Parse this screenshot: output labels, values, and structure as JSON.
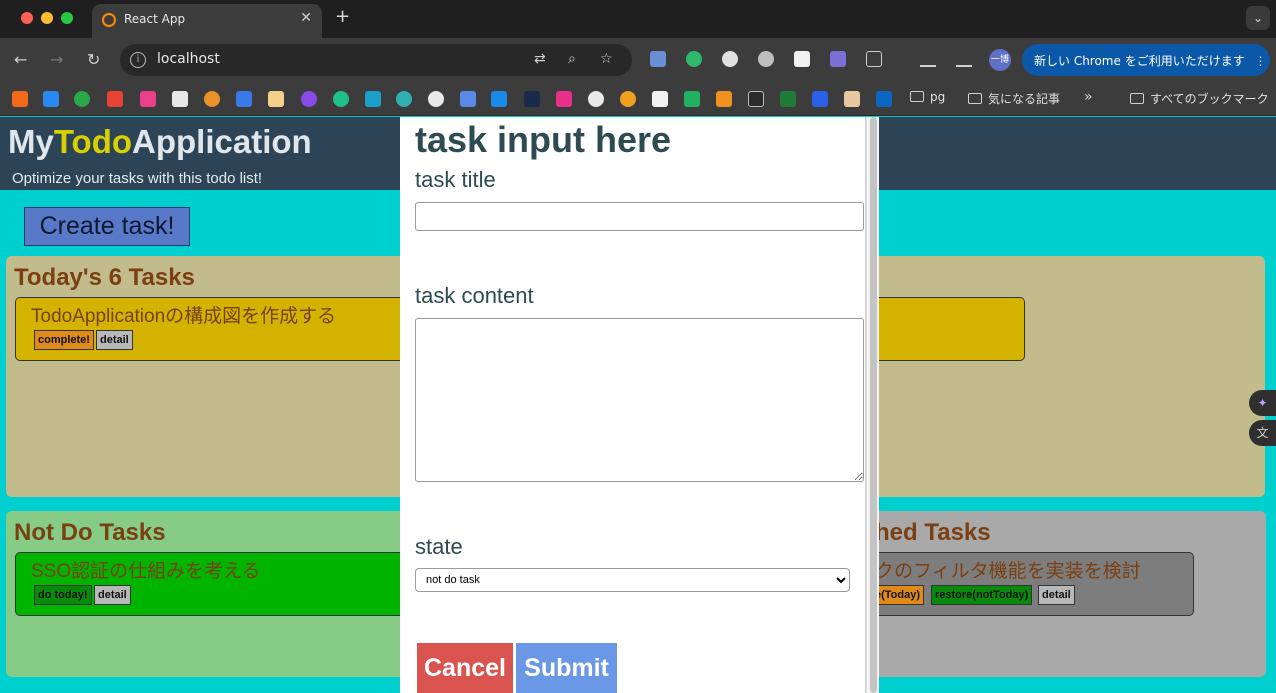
{
  "browser": {
    "tab_title": "React App",
    "new_tab": "+",
    "url": "localhost",
    "update_chip": "新しい Chrome をご利用いただけます",
    "more_glyph": "⋮",
    "bookmark_folders": [
      "pg",
      "気になる記事",
      "すべてのブックマーク"
    ]
  },
  "app": {
    "title_part1": "My",
    "title_part2": "Todo",
    "title_part3": "Application",
    "subtitle": "Optimize your tasks with this todo list!",
    "create_button": "Create task!"
  },
  "panels": {
    "today": {
      "title": "Today's 6 Tasks",
      "task_title": "TodoApplicationの構成図を作成する",
      "btn_complete": "complete!",
      "btn_detail": "detail"
    },
    "notdo": {
      "title": "Not Do Tasks",
      "task_title": "SSO認証の仕組みを考える",
      "btn_do_today": "do today!",
      "btn_detail": "detail"
    },
    "finished": {
      "title": "hed Tasks",
      "task_title": "クのフィルタ機能を実装を検討",
      "btn_restore_today": "e(Today)",
      "btn_restore_not_today": "restore(notToday)",
      "btn_detail": "detail"
    }
  },
  "modal": {
    "heading": "task input here",
    "title_label": "task title",
    "title_value": "",
    "content_label": "task content",
    "content_value": "",
    "state_label": "state",
    "state_selected": "not do task",
    "cancel": "Cancel",
    "submit": "Submit"
  },
  "colors": {
    "header_bg": "#2d4456",
    "accent_title": "#d8d000",
    "page_bg": "#00cfd0",
    "cancel": "#d9534f",
    "submit": "#6b98e6"
  }
}
